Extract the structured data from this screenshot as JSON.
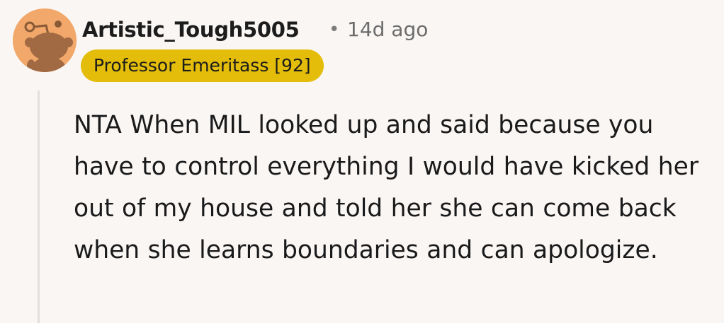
{
  "comment": {
    "author": "Artistic_Tough5005",
    "separator": "•",
    "timestamp": "14d ago",
    "flair": "Professor Emeritass [92]",
    "body": "NTA When MIL looked up and said because you have to control everything I would have kicked her out of my house and told her she can come back when she learns boundaries and can apologize."
  },
  "colors": {
    "background": "#f9f6f4",
    "avatar_background": "#f2a86a",
    "snoo_body": "#a16a42",
    "flair_background": "#e3bd0a",
    "thread_line": "#e2dfdc"
  },
  "icons": {
    "avatar": "snoo-avatar-icon"
  }
}
